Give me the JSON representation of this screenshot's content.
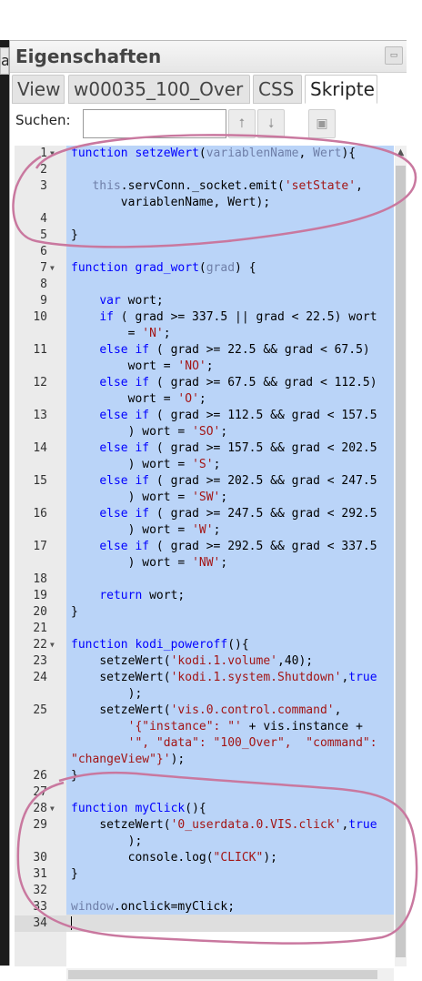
{
  "edge_text": "a",
  "panel": {
    "title": "Eigenschaften"
  },
  "tabs": [
    {
      "label": "View"
    },
    {
      "label": "w00035_100_Over"
    },
    {
      "label": "CSS"
    },
    {
      "label": "Skripte"
    }
  ],
  "search": {
    "label": "Suchen:",
    "value": "",
    "placeholder": ""
  },
  "icons": {
    "up": "arrow-up-icon",
    "down": "arrow-down-icon",
    "save": "save-icon",
    "collapse": "collapse-icon"
  },
  "code_lines": [
    {
      "n": "1",
      "fold": true,
      "html": "<span class=\"kw\">function</span> <span class=\"fn\">setzeWert</span>(<span class=\"var\">variablenName</span>, <span class=\"var\">Wert</span>){"
    },
    {
      "n": "2",
      "html": ""
    },
    {
      "n": "3",
      "html": "   <span class=\"var\">this</span>.servConn._socket.emit(<span class=\"str\">'setState'</span>,\n       variablenName, Wert);"
    },
    {
      "n": "4",
      "html": ""
    },
    {
      "n": "5",
      "html": "}"
    },
    {
      "n": "6",
      "html": ""
    },
    {
      "n": "7",
      "fold": true,
      "html": "<span class=\"kw\">function</span> <span class=\"fn\">grad_wort</span>(<span class=\"var\">grad</span>) {"
    },
    {
      "n": "8",
      "html": ""
    },
    {
      "n": "9",
      "html": "    <span class=\"kw\">var</span> wort;"
    },
    {
      "n": "10",
      "html": "    <span class=\"kw\">if</span> ( grad &gt;= 337.5 || grad &lt; 22.5) wort\n        = <span class=\"str\">'N'</span>;"
    },
    {
      "n": "11",
      "html": "    <span class=\"kw\">else if</span> ( grad &gt;= 22.5 &amp;&amp; grad &lt; 67.5)\n        wort = <span class=\"str\">'NO'</span>;"
    },
    {
      "n": "12",
      "html": "    <span class=\"kw\">else if</span> ( grad &gt;= 67.5 &amp;&amp; grad &lt; 112.5)\n        wort = <span class=\"str\">'O'</span>;"
    },
    {
      "n": "13",
      "html": "    <span class=\"kw\">else if</span> ( grad &gt;= 112.5 &amp;&amp; grad &lt; 157.5\n        ) wort = <span class=\"str\">'SO'</span>;"
    },
    {
      "n": "14",
      "html": "    <span class=\"kw\">else if</span> ( grad &gt;= 157.5 &amp;&amp; grad &lt; 202.5\n        ) wort = <span class=\"str\">'S'</span>;"
    },
    {
      "n": "15",
      "html": "    <span class=\"kw\">else if</span> ( grad &gt;= 202.5 &amp;&amp; grad &lt; 247.5\n        ) wort = <span class=\"str\">'SW'</span>;"
    },
    {
      "n": "16",
      "html": "    <span class=\"kw\">else if</span> ( grad &gt;= 247.5 &amp;&amp; grad &lt; 292.5\n        ) wort = <span class=\"str\">'W'</span>;"
    },
    {
      "n": "17",
      "html": "    <span class=\"kw\">else if</span> ( grad &gt;= 292.5 &amp;&amp; grad &lt; 337.5\n        ) wort = <span class=\"str\">'NW'</span>;"
    },
    {
      "n": "18",
      "html": ""
    },
    {
      "n": "19",
      "html": "    <span class=\"kw\">return</span> wort;"
    },
    {
      "n": "20",
      "html": "}"
    },
    {
      "n": "21",
      "html": ""
    },
    {
      "n": "22",
      "fold": true,
      "html": "<span class=\"kw\">function</span> <span class=\"fn\">kodi_poweroff</span>(){"
    },
    {
      "n": "23",
      "html": "    setzeWert(<span class=\"str\">'kodi.1.volume'</span>,40);"
    },
    {
      "n": "24",
      "html": "    setzeWert(<span class=\"str\">'kodi.1.system.Shutdown'</span>,<span class=\"kw\">true</span>\n        );"
    },
    {
      "n": "25",
      "html": "    setzeWert(<span class=\"str\">'vis.0.control.command'</span>,\n        <span class=\"str\">'{\"instance\": \"'</span> + vis.instance +\n        <span class=\"str\">'\", \"data\": \"100_Over\",  \"command\":\n\"changeView\"}'</span>);"
    },
    {
      "n": "26",
      "html": "}"
    },
    {
      "n": "27",
      "html": ""
    },
    {
      "n": "28",
      "fold": true,
      "html": "<span class=\"kw\">function</span> <span class=\"fn\">myClick</span>(){"
    },
    {
      "n": "29",
      "html": "    setzeWert(<span class=\"str\">'0_userdata.0.VIS.click'</span>,<span class=\"kw\">true</span>\n        );"
    },
    {
      "n": "30",
      "html": "        console.log(<span class=\"str\">\"CLICK\"</span>);"
    },
    {
      "n": "31",
      "html": "}"
    },
    {
      "n": "32",
      "html": ""
    },
    {
      "n": "33",
      "html": "<span class=\"var\">window</span>.onclick=myClick;"
    },
    {
      "n": "34",
      "html": "<span class=\"cur\"></span>"
    }
  ]
}
